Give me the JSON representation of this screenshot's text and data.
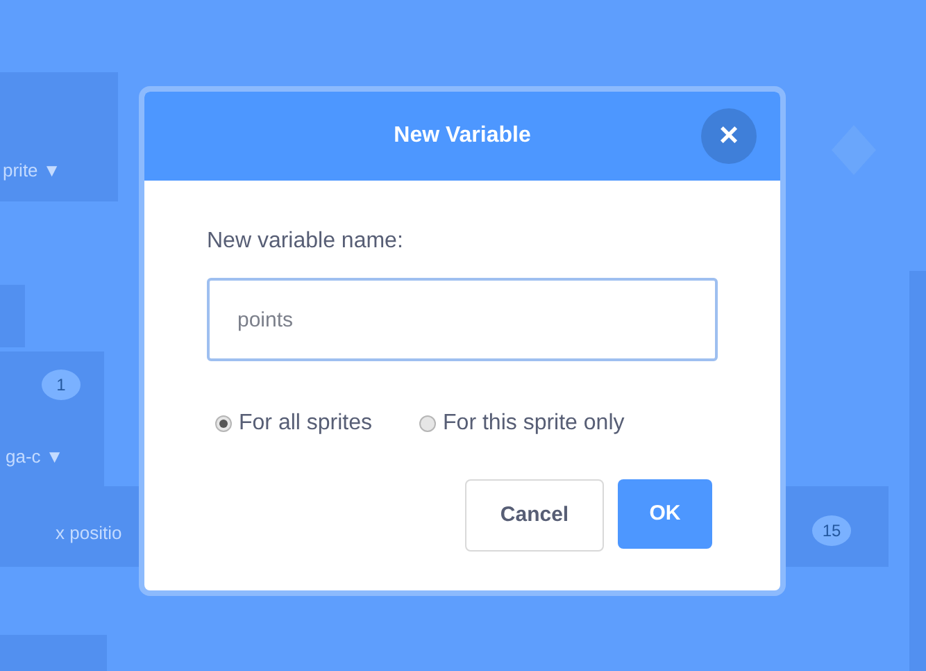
{
  "background": {
    "texts": [
      {
        "kind": "dropdown",
        "text": "prite ▼"
      },
      {
        "kind": "bubble",
        "text": "1"
      },
      {
        "kind": "dropdown",
        "text": "ga-c ▼"
      },
      {
        "kind": "label",
        "text": "x positio"
      },
      {
        "kind": "bubble",
        "text": "15"
      }
    ]
  },
  "dialog": {
    "title": "New Variable",
    "close": "×",
    "label": "New variable name:",
    "value": "points",
    "scope": [
      {
        "label": "For all sprites",
        "selected": true
      },
      {
        "label": "For this sprite only",
        "selected": false
      }
    ],
    "buttons": [
      {
        "label": "Cancel",
        "kind": "secondary"
      },
      {
        "label": "OK",
        "kind": "primary"
      }
    ]
  }
}
